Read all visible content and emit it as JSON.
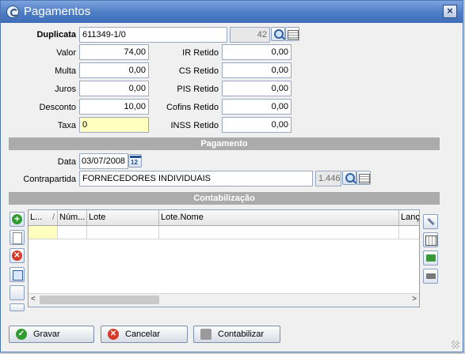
{
  "window": {
    "title": "Pagamentos"
  },
  "duplicata": {
    "label": "Duplicata",
    "value": "611349-1/0",
    "code": "42"
  },
  "fields": {
    "valor": {
      "label": "Valor",
      "value": "74,00"
    },
    "multa": {
      "label": "Multa",
      "value": "0,00"
    },
    "juros": {
      "label": "Juros",
      "value": "0,00"
    },
    "desconto": {
      "label": "Desconto",
      "value": "10,00"
    },
    "taxa": {
      "label": "Taxa",
      "value": "0"
    },
    "ir": {
      "label": "IR Retido",
      "value": "0,00"
    },
    "cs": {
      "label": "CS Retido",
      "value": "0,00"
    },
    "pis": {
      "label": "PIS Retido",
      "value": "0,00"
    },
    "cofins": {
      "label": "Cofins Retido",
      "value": "0,00"
    },
    "inss": {
      "label": "INSS Retido",
      "value": "0,00"
    }
  },
  "pagamento": {
    "header": "Pagamento",
    "data_label": "Data",
    "data_value": "03/07/2008",
    "contrapartida_label": "Contrapartida",
    "contrapartida_value": "FORNECEDORES INDIVIDUAIS",
    "contrapartida_code": "1.446"
  },
  "contabilizacao": {
    "header": "Contabilização",
    "columns": [
      "L...",
      "Núm...",
      "Lote",
      "Lote.Nome",
      "Lanç"
    ],
    "sort_indicator": "/"
  },
  "buttons": {
    "gravar": "Gravar",
    "cancelar": "Cancelar",
    "contabilizar": "Contabilizar"
  },
  "icons": {
    "close": "close-icon",
    "search": "search-icon",
    "list": "list-icon",
    "calendar": "calendar-icon"
  },
  "colors": {
    "title_bar": "#4d7cc4",
    "section_bar": "#ababab",
    "taxa_field": "#ffffc0"
  }
}
